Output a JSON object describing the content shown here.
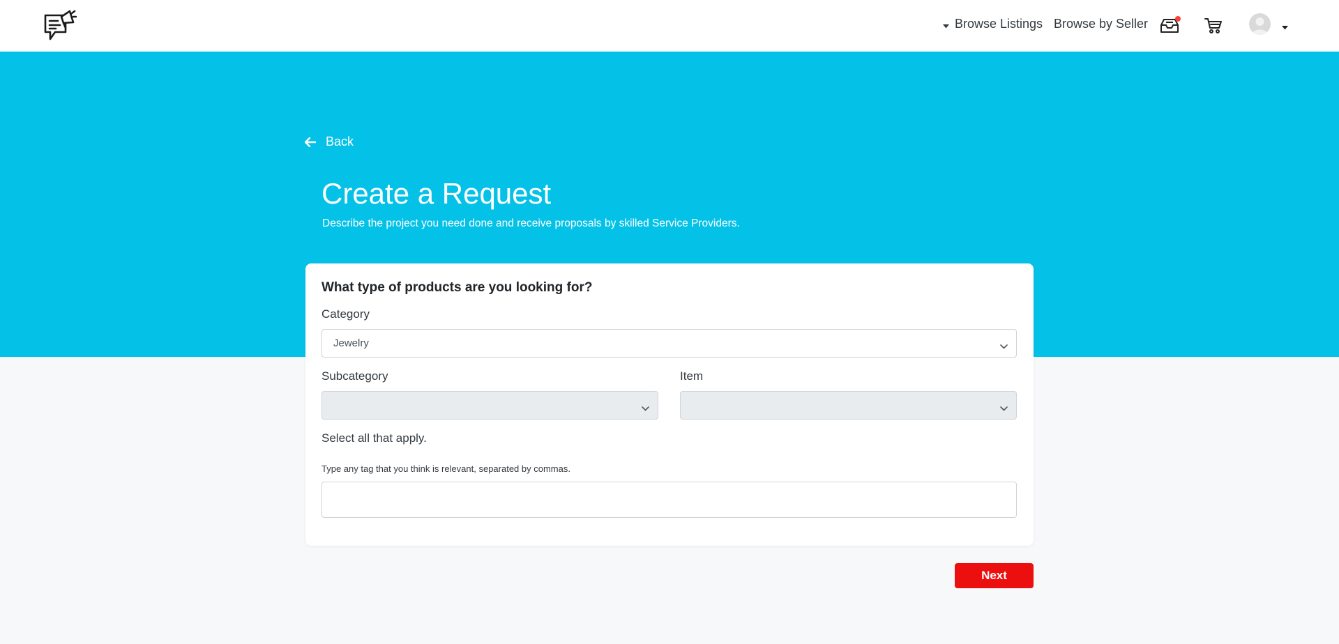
{
  "header": {
    "logo_icon": "megaphone-chat-icon",
    "nav": {
      "browse_listings": "Browse Listings",
      "browse_by_seller": "Browse by Seller"
    },
    "icons": {
      "inbox": "inbox-tray-icon",
      "cart": "shopping-cart-icon",
      "avatar": "user-avatar-icon"
    },
    "notification_color": "#f44336"
  },
  "hero": {
    "background": "#04c2e7",
    "back_label": "Back",
    "title": "Create a Request",
    "subtitle": "Describe the project you need done and receive proposals by skilled Service Providers."
  },
  "form": {
    "question": "What type of products are you looking for?",
    "category": {
      "label": "Category",
      "value": "Jewelry"
    },
    "subcategory": {
      "label": "Subcategory",
      "value": ""
    },
    "item": {
      "label": "Item",
      "value": ""
    },
    "select_all": "Select all that apply.",
    "tags_hint": "Type any tag that you think is relevant, separated by commas.",
    "tags_value": ""
  },
  "actions": {
    "next_label": "Next",
    "next_color": "#ec0f0f"
  }
}
